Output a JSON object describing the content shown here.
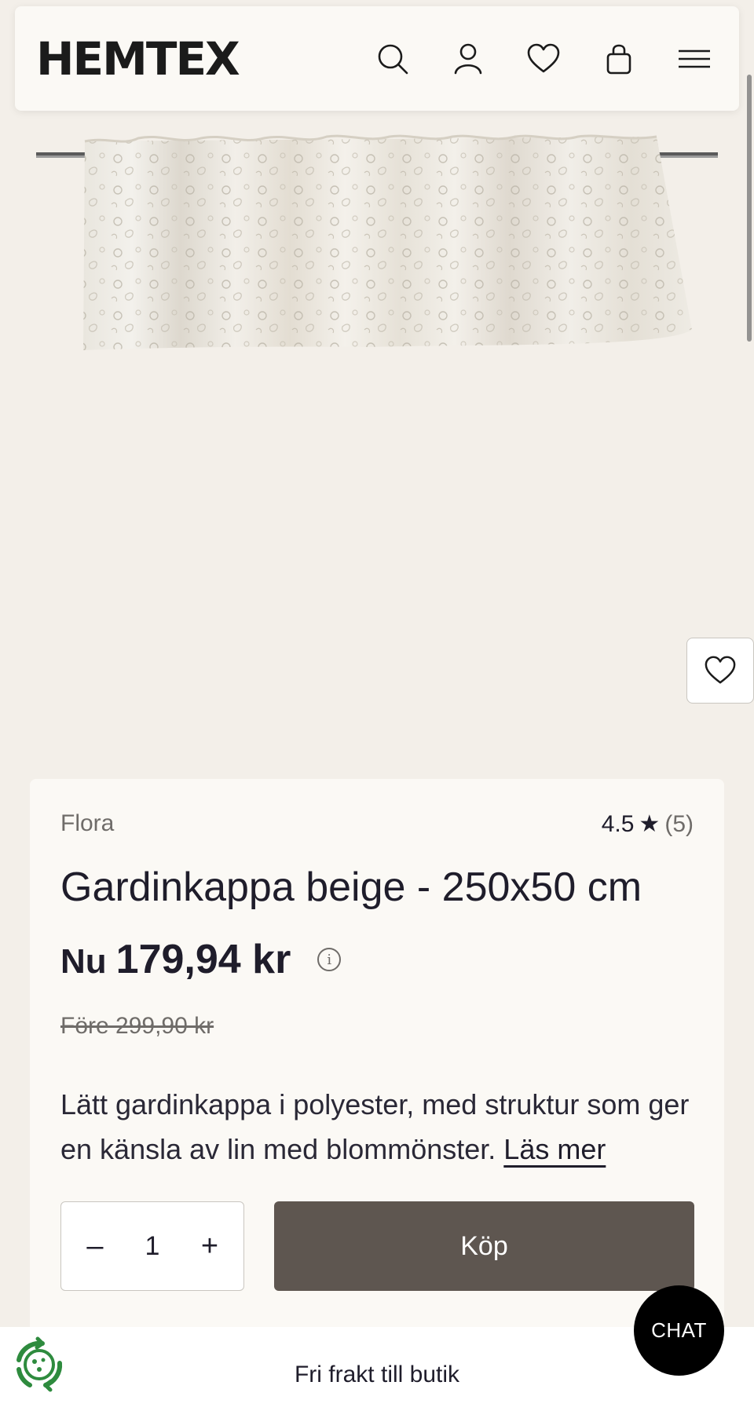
{
  "header": {
    "logo": "HEMTEX",
    "icons": [
      "search-icon",
      "account-icon",
      "wishlist-icon",
      "cart-icon",
      "menu-icon"
    ]
  },
  "product": {
    "brand": "Flora",
    "rating": "4.5",
    "rating_star": "★",
    "review_count": "(5)",
    "title": "Gardinkappa beige - 250x50 cm",
    "price_prefix": "Nu",
    "price_now": "179,94 kr",
    "price_before": "Före 299,90 kr",
    "description": "Lätt gardinkappa i polyester, med struktur som ger en känsla av lin med blommönster.",
    "read_more": "Läs mer",
    "quantity": "1",
    "buy_label": "Köp"
  },
  "footer": {
    "shipping_text": "Fri frakt till butik"
  },
  "chat": {
    "label": "CHAT"
  },
  "colors": {
    "background": "#f3efe9",
    "card": "#fbf9f5",
    "buy_button": "#5e5650",
    "chat": "#000000",
    "recycle_green": "#2e8b3e"
  }
}
